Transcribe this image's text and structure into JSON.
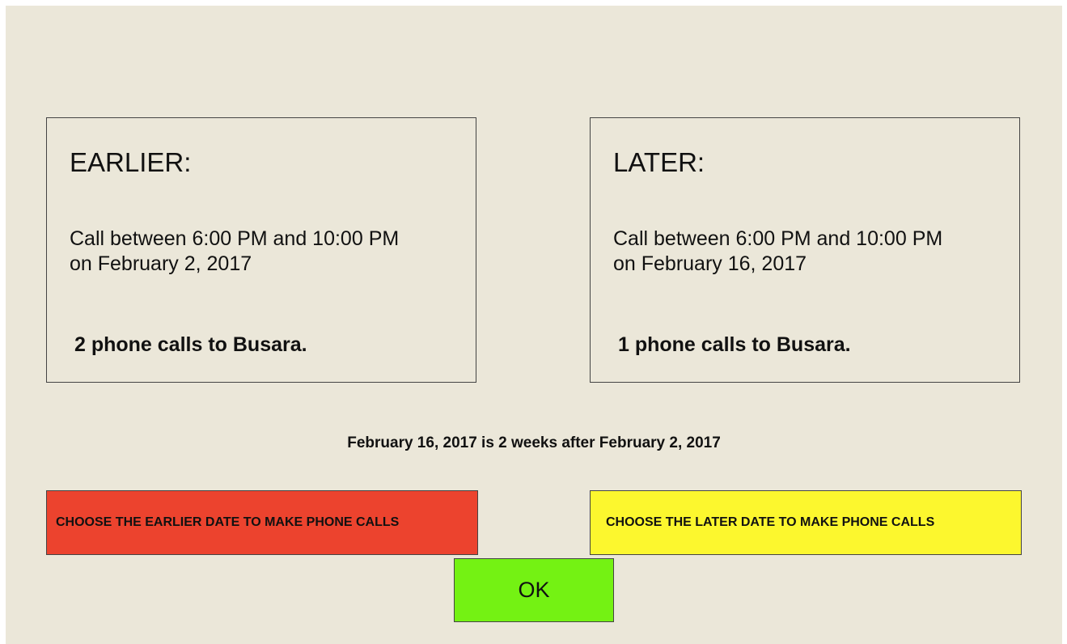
{
  "earlier": {
    "heading": "EARLIER:",
    "time_line1": "Call between 6:00 PM and 10:00 PM",
    "time_line2": "on February 2, 2017",
    "calls": "2 phone calls to Busara."
  },
  "later": {
    "heading": "LATER:",
    "time_line1": "Call between 6:00 PM and 10:00 PM",
    "time_line2": "on February 16, 2017",
    "calls": "1 phone calls to Busara."
  },
  "comparison_text": "February 16, 2017 is 2 weeks after February 2, 2017",
  "buttons": {
    "choose_earlier": "CHOOSE THE EARLIER DATE TO MAKE PHONE CALLS",
    "choose_later": "CHOOSE THE LATER DATE TO MAKE PHONE CALLS",
    "ok": "OK"
  },
  "colors": {
    "background": "#ebe7d9",
    "earlier_button": "#ec432e",
    "later_button": "#fcf72e",
    "ok_button": "#74f213"
  }
}
